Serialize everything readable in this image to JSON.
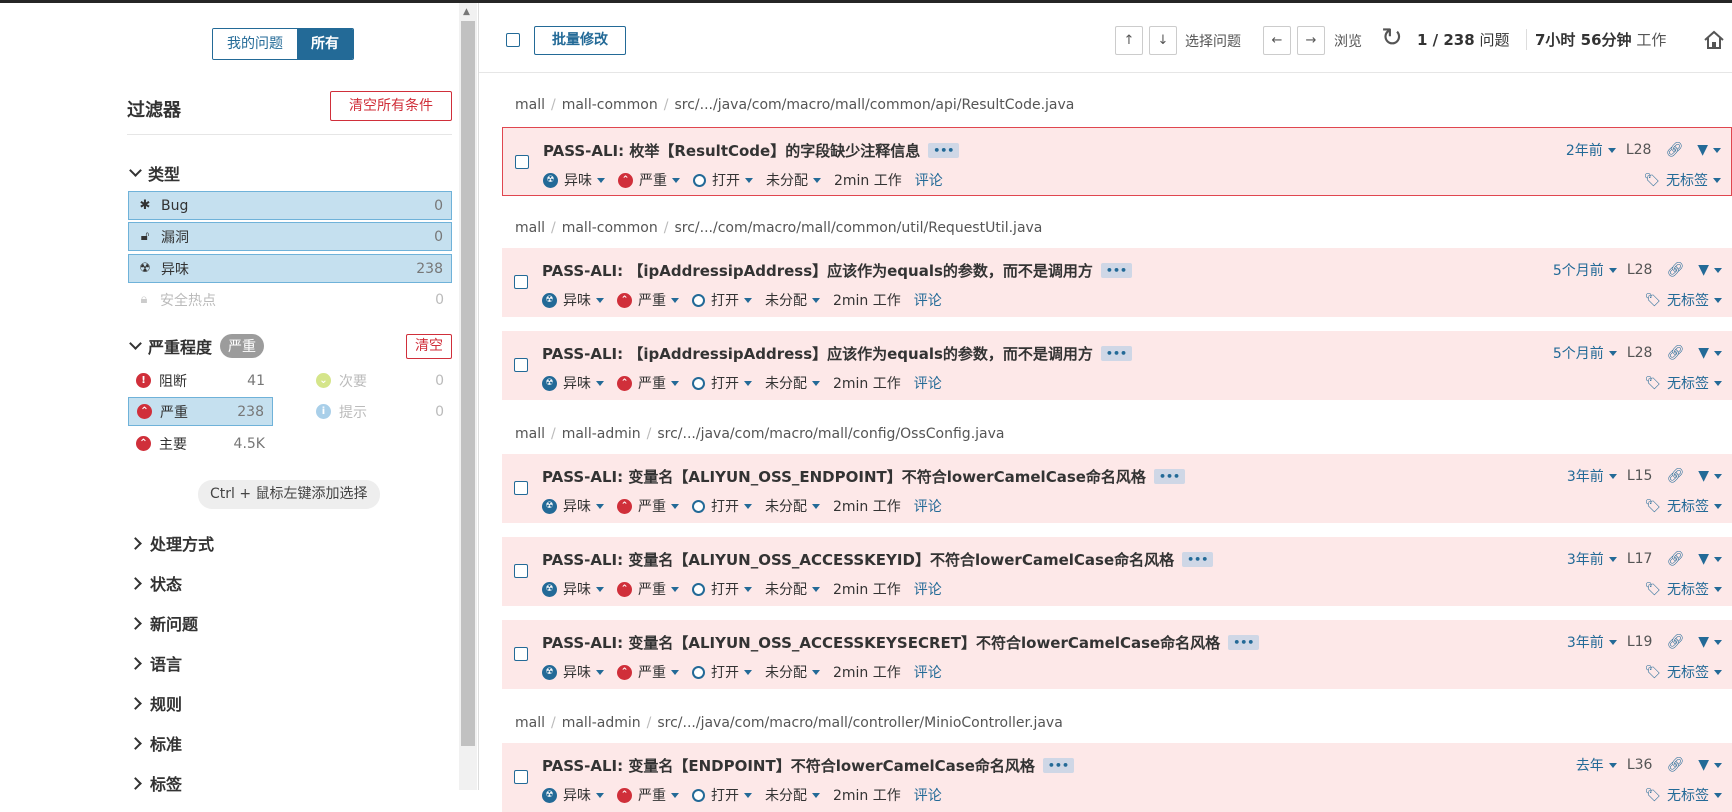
{
  "sidebar": {
    "toggle": {
      "mine": "我的问题",
      "all": "所有"
    },
    "filter_title": "过滤器",
    "clear_all": "清空所有条件",
    "type_section": "类型",
    "types": [
      {
        "label": "Bug",
        "count": "0",
        "icon": "bug-icon"
      },
      {
        "label": "漏洞",
        "count": "0",
        "icon": "unlock-icon"
      },
      {
        "label": "异味",
        "count": "238",
        "icon": "code-smell-icon"
      },
      {
        "label": "安全热点",
        "count": "0",
        "icon": "hotspot-icon"
      }
    ],
    "severity_section": "严重程度",
    "severity_badge": "严重",
    "clear": "清空",
    "severities": [
      {
        "label": "阻断",
        "count": "41",
        "color": "#d02f3a",
        "icon": "blocker-icon"
      },
      {
        "label": "次要",
        "count": "0",
        "color": "#b0d513",
        "icon": "minor-icon"
      },
      {
        "label": "严重",
        "count": "238",
        "color": "#d02f3a",
        "icon": "critical-icon"
      },
      {
        "label": "提示",
        "count": "0",
        "color": "#4b9fd5",
        "icon": "info-icon"
      },
      {
        "label": "主要",
        "count": "4.5K",
        "color": "#d02f3a",
        "icon": "major-icon"
      }
    ],
    "hint": "Ctrl + 鼠标左键添加选择",
    "collapsed": [
      "处理方式",
      "状态",
      "新问题",
      "语言",
      "规则",
      "标准",
      "标签"
    ]
  },
  "toolbar": {
    "bulk": "批量修改",
    "select_issue": "选择问题",
    "browse": "浏览",
    "count": "1 / 238",
    "count_label": "问题",
    "effort": "7小时 56分钟",
    "effort_label": "工作"
  },
  "issue_meta": {
    "type": "异味",
    "severity": "严重",
    "status": "打开",
    "assignee": "未分配",
    "effort": "2min 工作",
    "comment": "评论",
    "no_tags": "无标签"
  },
  "groups": [
    {
      "path": [
        "mall",
        "mall-common",
        "src/.../java/com/macro/mall/common/api/ResultCode.java"
      ],
      "issues": [
        {
          "title": "PASS-ALI: 枚举【ResultCode】的字段缺少注释信息",
          "age": "2年前",
          "line": "L28",
          "focused": true
        }
      ]
    },
    {
      "path": [
        "mall",
        "mall-common",
        "src/.../com/macro/mall/common/util/RequestUtil.java"
      ],
      "issues": [
        {
          "title": "PASS-ALI: 【ipAddressipAddress】应该作为equals的参数，而不是调用方",
          "age": "5个月前",
          "line": "L28"
        },
        {
          "title": "PASS-ALI: 【ipAddressipAddress】应该作为equals的参数，而不是调用方",
          "age": "5个月前",
          "line": "L28"
        }
      ]
    },
    {
      "path": [
        "mall",
        "mall-admin",
        "src/.../java/com/macro/mall/config/OssConfig.java"
      ],
      "issues": [
        {
          "title": "PASS-ALI: 变量名【ALIYUN_OSS_ENDPOINT】不符合lowerCamelCase命名风格",
          "age": "3年前",
          "line": "L15"
        },
        {
          "title": "PASS-ALI: 变量名【ALIYUN_OSS_ACCESSKEYID】不符合lowerCamelCase命名风格",
          "age": "3年前",
          "line": "L17"
        },
        {
          "title": "PASS-ALI: 变量名【ALIYUN_OSS_ACCESSKEYSECRET】不符合lowerCamelCase命名风格",
          "age": "3年前",
          "line": "L19"
        }
      ]
    },
    {
      "path": [
        "mall",
        "mall-admin",
        "src/.../java/com/macro/mall/controller/MinioController.java"
      ],
      "issues": [
        {
          "title": "PASS-ALI: 变量名【ENDPOINT】不符合lowerCamelCase命名风格",
          "age": "去年",
          "line": "L36"
        }
      ]
    }
  ]
}
